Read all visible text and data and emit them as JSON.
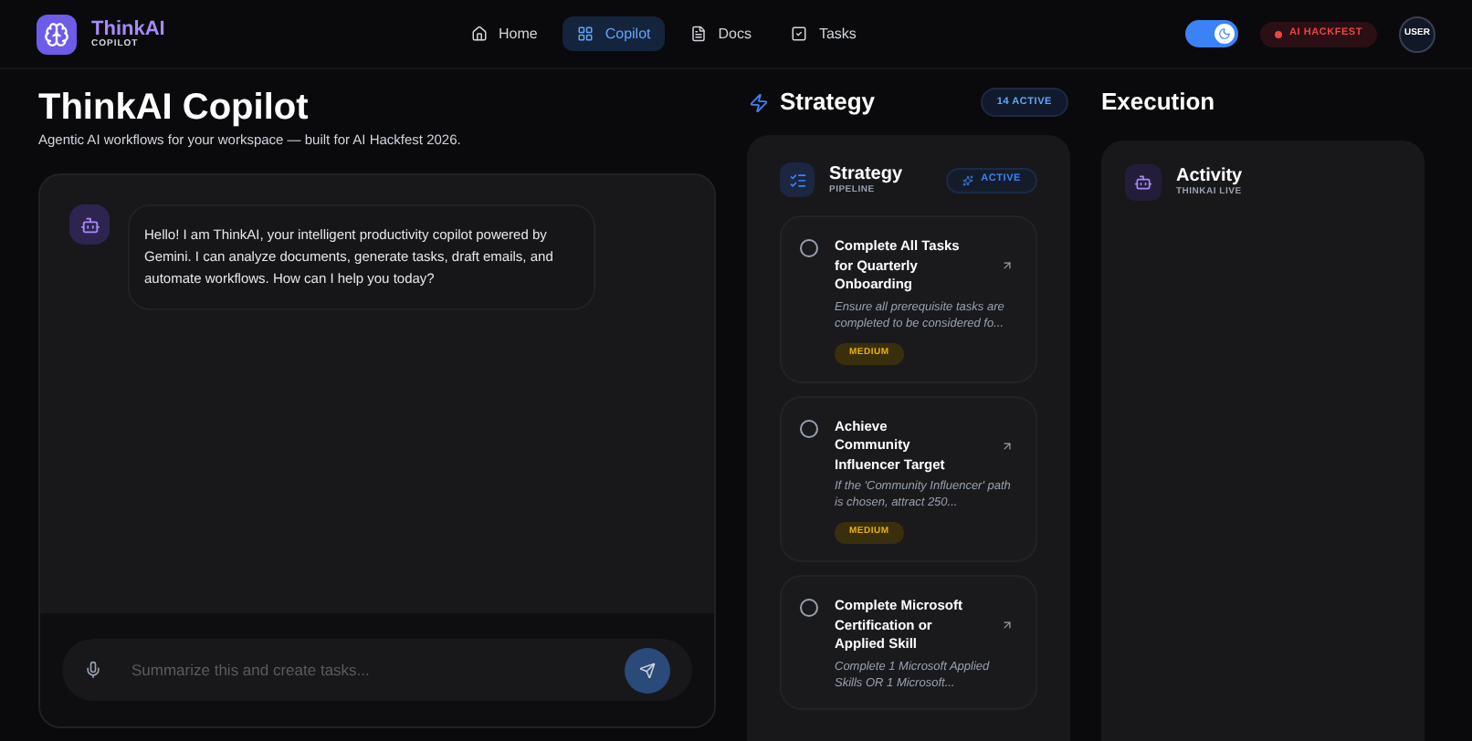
{
  "brand": {
    "name": "ThinkAI",
    "tagline": "COPILOT"
  },
  "nav": [
    {
      "label": "Home",
      "selected": false
    },
    {
      "label": "Copilot",
      "selected": true
    },
    {
      "label": "Docs",
      "selected": false
    },
    {
      "label": "Tasks",
      "selected": false
    }
  ],
  "theme_toggle": {
    "on": true
  },
  "event_badge": "AI HACKFEST",
  "user": "USER",
  "page": {
    "title": "ThinkAI Copilot",
    "subtitle": "Agentic AI workflows for your workspace — built for AI Hackfest 2026."
  },
  "chat": {
    "messages": [
      {
        "text": "Hello! I am ThinkAI, your intelligent productivity copilot powered by Gemini. I can analyze documents, generate tasks, draft emails, and automate workflows. How can I help you today?"
      }
    ],
    "input": {
      "placeholder": "Summarize this and create tasks..."
    }
  },
  "strategy": {
    "heading": "Strategy",
    "count_badge": "14 ACTIVE",
    "panel_title": "Strategy",
    "panel_subtitle": "PIPELINE",
    "status": "ACTIVE",
    "tasks": [
      {
        "title": "Complete All Tasks for Quarterly Onboarding",
        "description": "Ensure all prerequisite tasks are completed to be considered fo...",
        "checked": false,
        "priority": "MEDIUM"
      },
      {
        "title": "Achieve Community Influencer Target",
        "description": "If the 'Community Influencer' path is chosen, attract 250...",
        "checked": false,
        "priority": "MEDIUM"
      },
      {
        "title": "Complete Microsoft Certification or Applied Skill",
        "description": "Complete 1 Microsoft Applied Skills OR 1 Microsoft...",
        "checked": false
      }
    ]
  },
  "execution": {
    "heading": "Execution",
    "panel_title": "Activity",
    "panel_subtitle": "THINKAI LIVE"
  }
}
